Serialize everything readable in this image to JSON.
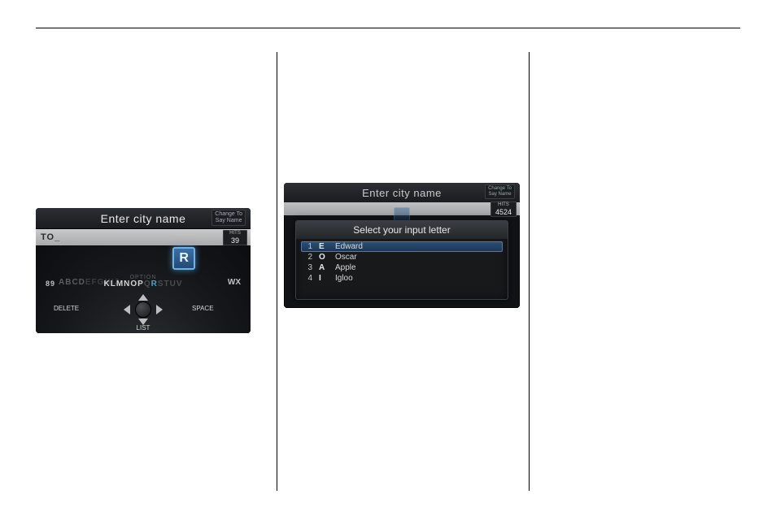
{
  "panel1": {
    "title": "Enter city name",
    "change_to": "Change To\nSay Name",
    "input_text": "TO_",
    "hits_label": "HITS",
    "hits_value": "39",
    "selected_letter": "R",
    "arc_left_nums": "89",
    "arc_left_letters": "ABCD",
    "arc_left_dim": "EFGHIJ",
    "arc_center": "KLMNOP",
    "arc_q": "Q",
    "arc_r": "R",
    "arc_dim_right": "STUV",
    "arc_right_wx": "WX",
    "option_label": "OPTION",
    "delete_label": "DELETE",
    "space_label": "SPACE",
    "list_label": "LIST"
  },
  "panel2": {
    "title": "Enter city name",
    "change_to": "Change To\nSay Name",
    "hits_label": "HITS",
    "hits_value": "4524",
    "modal_title": "Select your input letter",
    "rows": [
      {
        "idx": "1",
        "letter": "E",
        "word": "Edward"
      },
      {
        "idx": "2",
        "letter": "O",
        "word": "Oscar"
      },
      {
        "idx": "3",
        "letter": "A",
        "word": "Apple"
      },
      {
        "idx": "4",
        "letter": "I",
        "word": "Igloo"
      }
    ]
  }
}
